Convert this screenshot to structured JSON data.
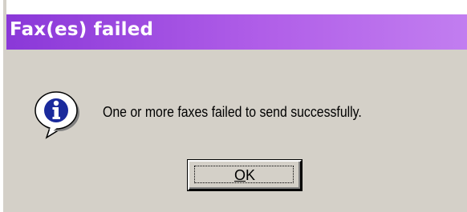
{
  "dialog": {
    "title": "Fax(es) failed",
    "icon": "information-icon",
    "message": "One or more faxes failed to send successfully.",
    "ok_label": "OK",
    "ok_accelerator": "O"
  },
  "colors": {
    "titlebar_start": "#8a38d8",
    "titlebar_end": "#c27ef0",
    "dialog_background": "#d4d0c8",
    "icon_blue": "#1a2a9c"
  }
}
